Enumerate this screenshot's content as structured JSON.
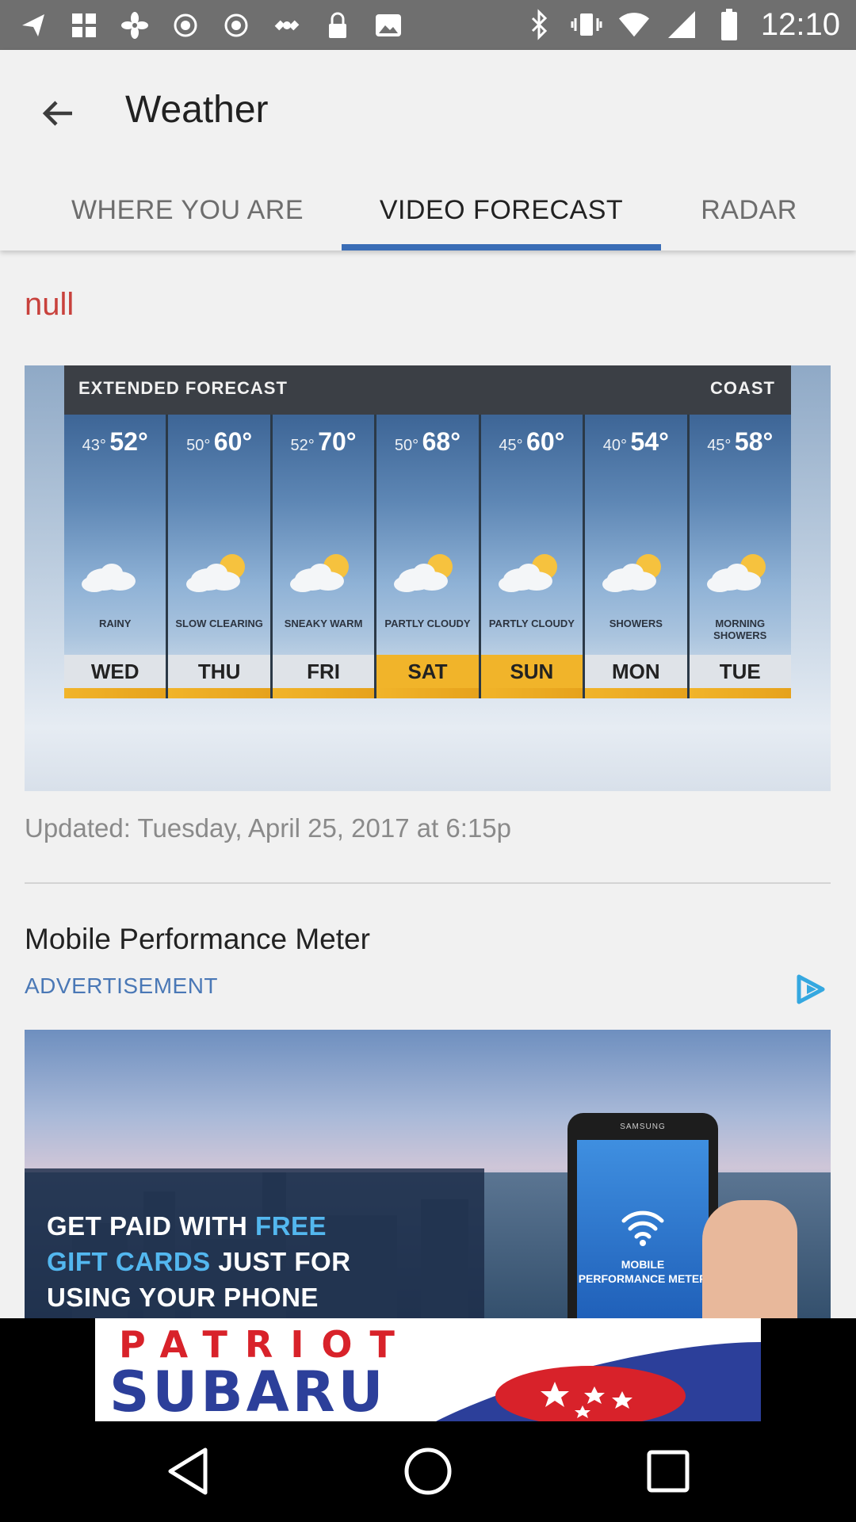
{
  "status_bar": {
    "time": "12:10",
    "left_icons": [
      "navigation-arrow-icon",
      "grid-icon",
      "fan-icon",
      "record-icon",
      "record-icon",
      "satellite-icon",
      "lock-icon",
      "photo-icon"
    ],
    "right_icons": [
      "bluetooth-icon",
      "vibrate-icon",
      "wifi-icon",
      "signal-icon",
      "battery-icon"
    ]
  },
  "app_bar": {
    "title": "Weather",
    "tabs": [
      {
        "label": "WHERE YOU ARE",
        "active": false
      },
      {
        "label": "VIDEO FORECAST",
        "active": true
      },
      {
        "label": "RADAR",
        "active": false
      }
    ],
    "accent_color": "#3a6db6"
  },
  "content": {
    "location_text": "null",
    "forecast_image": {
      "header_left": "EXTENDED FORECAST",
      "header_right": "COAST",
      "days": [
        {
          "day": "WED",
          "low": "43°",
          "high": "52°",
          "condition": "RAINY",
          "highlight": false
        },
        {
          "day": "THU",
          "low": "50°",
          "high": "60°",
          "condition": "SLOW CLEARING",
          "highlight": false
        },
        {
          "day": "FRI",
          "low": "52°",
          "high": "70°",
          "condition": "SNEAKY WARM",
          "highlight": false
        },
        {
          "day": "SAT",
          "low": "50°",
          "high": "68°",
          "condition": "PARTLY CLOUDY",
          "highlight": true
        },
        {
          "day": "SUN",
          "low": "45°",
          "high": "60°",
          "condition": "PARTLY CLOUDY",
          "highlight": true
        },
        {
          "day": "MON",
          "low": "40°",
          "high": "54°",
          "condition": "SHOWERS",
          "highlight": false
        },
        {
          "day": "TUE",
          "low": "45°",
          "high": "58°",
          "condition": "MORNING SHOWERS",
          "highlight": false
        }
      ]
    },
    "updated_text": "Updated: Tuesday, April 25, 2017 at 6:15p",
    "ad": {
      "title": "Mobile Performance Meter",
      "label": "ADVERTISEMENT",
      "label_color": "#4a78b6",
      "image_text_line1_white": "GET PAID WITH ",
      "image_text_line1_blue": "FREE",
      "image_text_line2_blue": "GIFT CARDS",
      "image_text_line2_white": " JUST FOR",
      "image_text_line3": "USING YOUR PHONE",
      "phone_brand": "SAMSUNG",
      "phone_screen_text": "MOBILE PERFORMANCE METER"
    }
  },
  "banner": {
    "line1": "PATRIOT",
    "line2": "SUBARU"
  },
  "nav_bar": {
    "buttons": [
      "back-nav-icon",
      "home-nav-icon",
      "recents-nav-icon"
    ]
  }
}
